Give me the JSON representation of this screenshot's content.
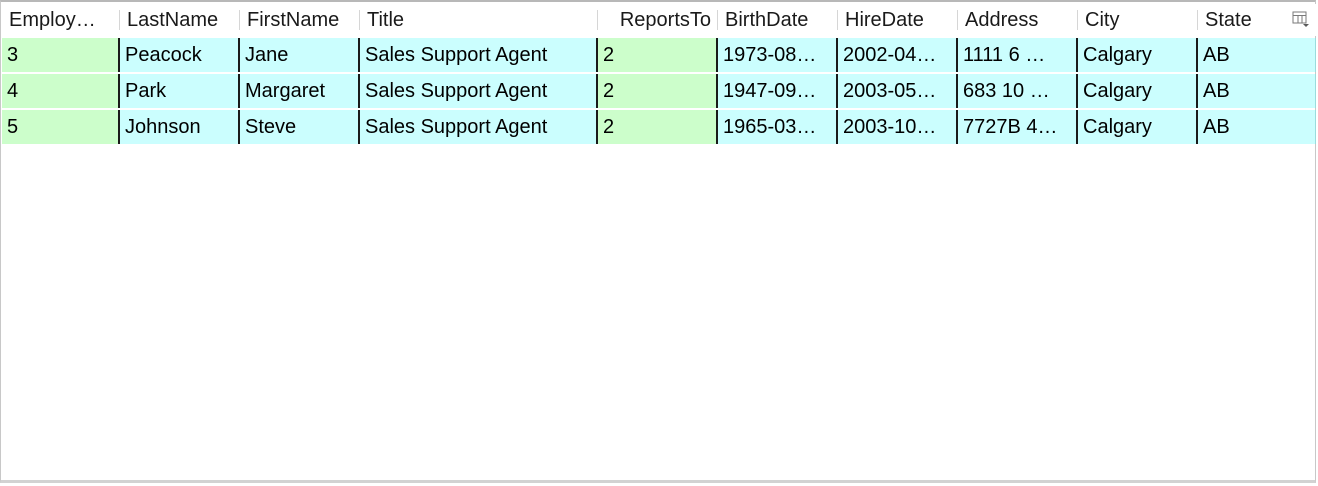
{
  "table": {
    "columns": [
      {
        "label": "Employ…",
        "kind": "key"
      },
      {
        "label": "LastName",
        "kind": "std"
      },
      {
        "label": "FirstName",
        "kind": "std"
      },
      {
        "label": "Title",
        "kind": "std"
      },
      {
        "label": "ReportsTo",
        "kind": "key"
      },
      {
        "label": "BirthDate",
        "kind": "std"
      },
      {
        "label": "HireDate",
        "kind": "std"
      },
      {
        "label": "Address",
        "kind": "std"
      },
      {
        "label": "City",
        "kind": "std"
      },
      {
        "label": "State",
        "kind": "std"
      }
    ],
    "rows": [
      [
        "3",
        "Peacock",
        "Jane",
        "Sales Support Agent",
        "2",
        "1973-08…",
        "2002-04…",
        "1111 6 …",
        "Calgary",
        "AB"
      ],
      [
        "4",
        "Park",
        "Margaret",
        "Sales Support Agent",
        "2",
        "1947-09…",
        "2003-05…",
        "683 10 …",
        "Calgary",
        "AB"
      ],
      [
        "5",
        "Johnson",
        "Steve",
        "Sales Support Agent",
        "2",
        "1965-03…",
        "2003-10…",
        "7727B 4…",
        "Calgary",
        "AB"
      ]
    ],
    "colors": {
      "key_cell": "#ccfecb",
      "standard_cell": "#cbfefe",
      "cell_divider": "#1a1a1a"
    }
  },
  "icons": {
    "column_chooser": "column-chooser-icon"
  }
}
